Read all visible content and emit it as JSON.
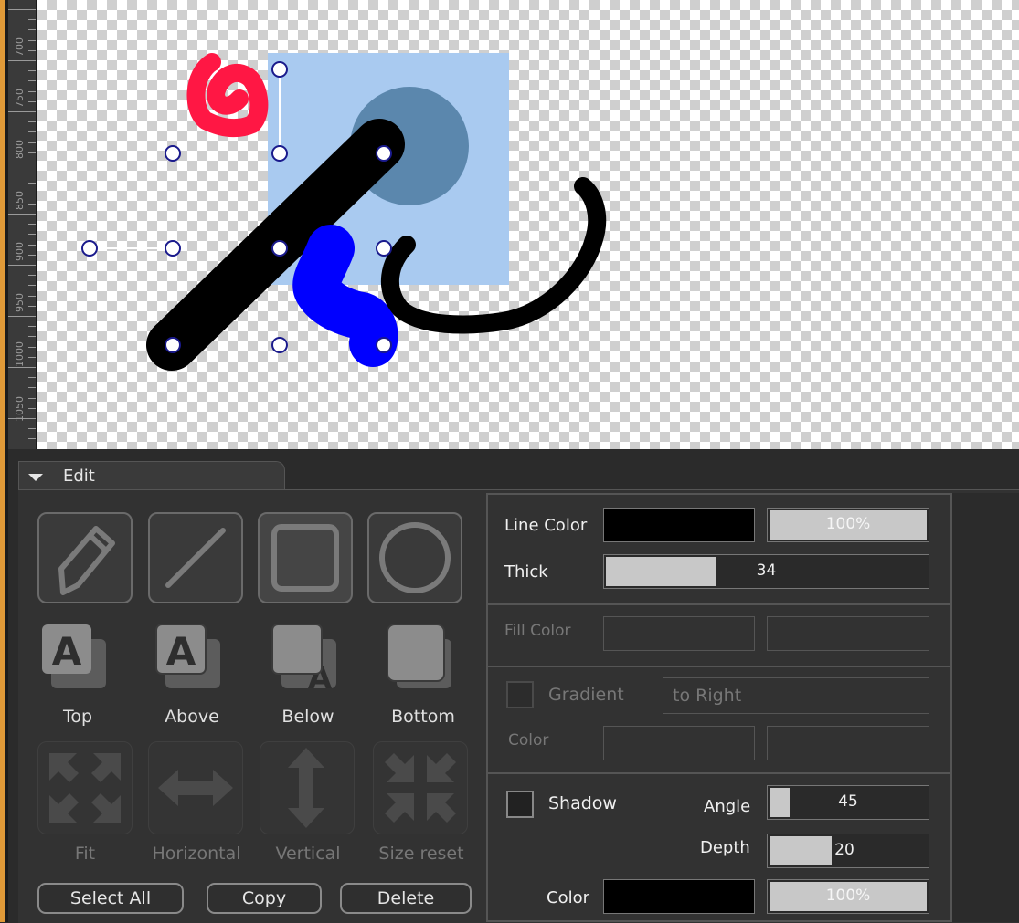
{
  "ruler": {
    "labels": [
      "700",
      "750",
      "800",
      "850",
      "900",
      "950",
      "1000",
      "1050"
    ]
  },
  "tab": {
    "label": "Edit",
    "icon": "triangle-down-icon"
  },
  "tools": [
    {
      "name": "pencil",
      "icon": "pencil-icon"
    },
    {
      "name": "line",
      "icon": "line-icon"
    },
    {
      "name": "rectangle",
      "icon": "rectangle-icon"
    },
    {
      "name": "ellipse",
      "icon": "ellipse-icon"
    }
  ],
  "order": {
    "top": "Top",
    "above": "Above",
    "below": "Below",
    "bottom": "Bottom"
  },
  "resize": {
    "fit": "Fit",
    "horizontal": "Horizontal",
    "vertical": "Vertical",
    "size_reset": "Size reset"
  },
  "actions": {
    "select_all": "Select All",
    "copy": "Copy",
    "delete": "Delete"
  },
  "properties": {
    "line_color": {
      "label": "Line Color",
      "color": "#000000",
      "opacity": "100%",
      "opacity_value": 1.0
    },
    "thick": {
      "label": "Thick",
      "value": "34",
      "fill_fraction": 0.34
    },
    "fill_color": {
      "label": "Fill Color"
    },
    "gradient": {
      "label": "Gradient",
      "direction": "to Right",
      "color_label": "Color"
    },
    "shadow": {
      "label": "Shadow",
      "angle_label": "Angle",
      "angle": "45",
      "angle_fraction": 0.125,
      "depth_label": "Depth",
      "depth": "20",
      "depth_fraction": 0.4,
      "color_label": "Color",
      "color": "#000000",
      "opacity": "100%",
      "opacity_value": 1.0
    }
  },
  "colors": {
    "accent": "#e09a38",
    "light_blue": "#a9caf0",
    "steel_blue": "#5b87ad",
    "red": "#ff1744",
    "blue": "#0000ff"
  }
}
